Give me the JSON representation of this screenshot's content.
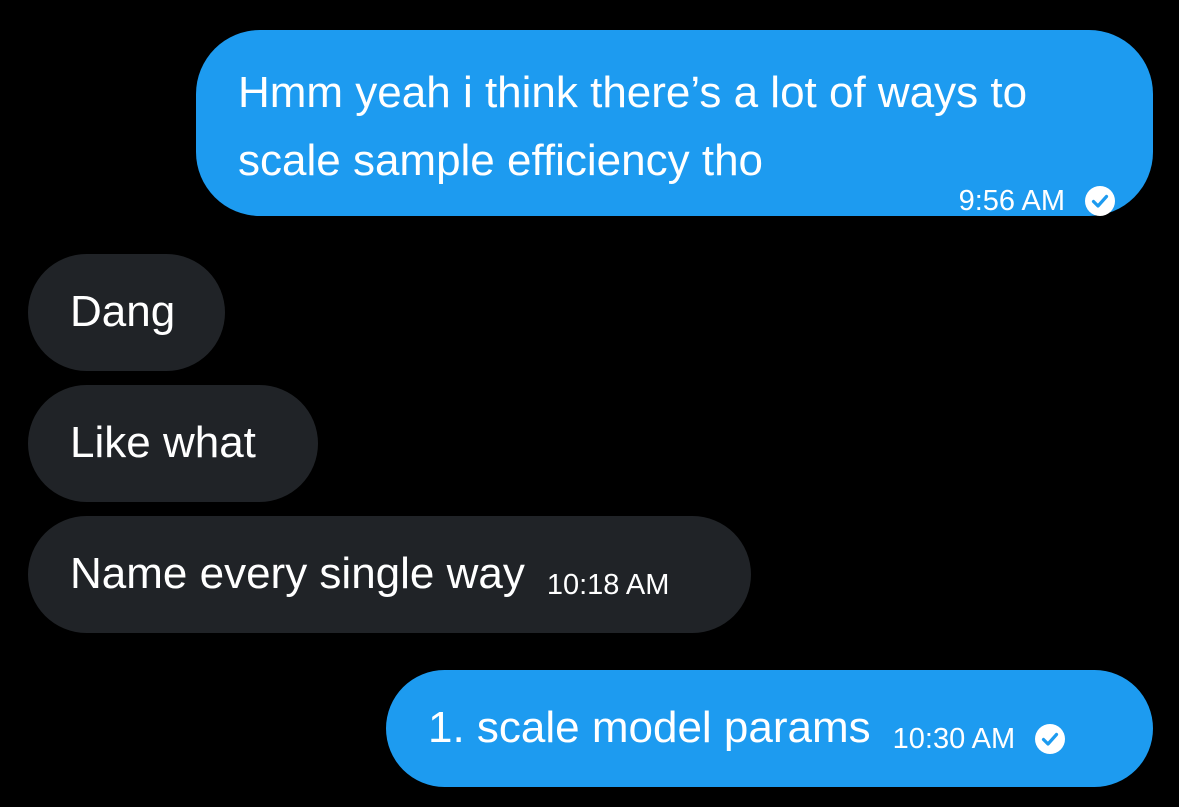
{
  "messages": [
    {
      "direction": "sent",
      "text": "Hmm yeah i think there’s a lot of ways to scale sample efficiency tho",
      "time": "9:56 AM",
      "status_icon": "check-circle-icon"
    },
    {
      "direction": "received",
      "text": "Dang"
    },
    {
      "direction": "received",
      "text": "Like what"
    },
    {
      "direction": "received",
      "text": "Name every single way",
      "time": "10:18 AM"
    },
    {
      "direction": "sent",
      "text": "1. scale model params",
      "time": "10:30 AM",
      "status_icon": "check-circle-icon"
    }
  ],
  "colors": {
    "background": "#000000",
    "sent_bubble": "#1d9bf0",
    "received_bubble": "#202327",
    "text": "#ffffff"
  }
}
